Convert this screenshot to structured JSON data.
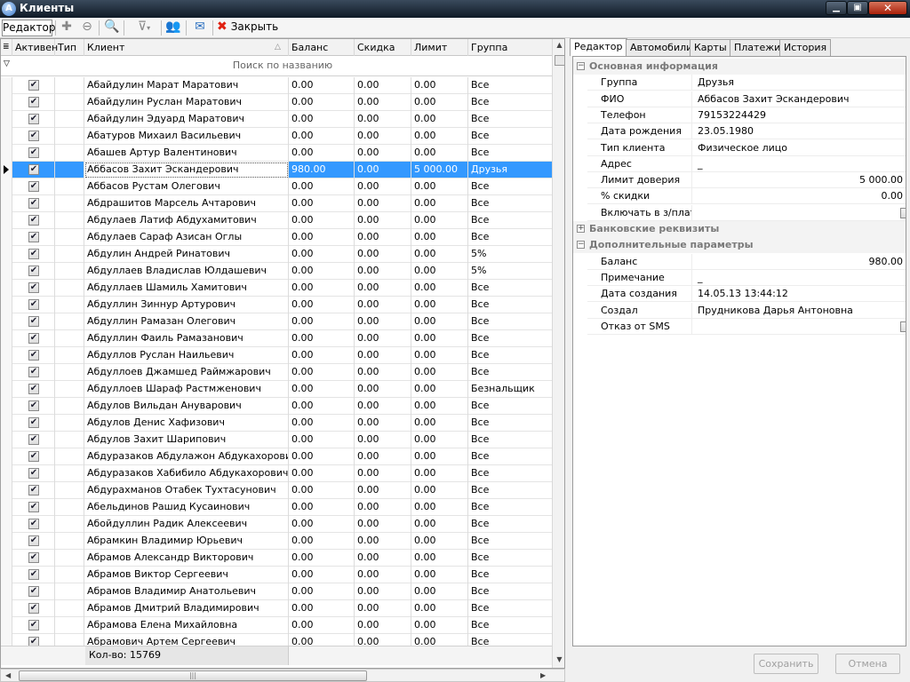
{
  "window": {
    "title": "Клиенты",
    "app_icon_letter": "A",
    "minimize": "▁",
    "maximize": "▣",
    "close": "✕"
  },
  "toolbar": {
    "editor_label": "Редактор",
    "close_label": "Закрыть"
  },
  "grid": {
    "columns": [
      "Активен",
      "Тип",
      "Клиент",
      "Баланс",
      "Скидка",
      "Лимит",
      "Группа"
    ],
    "sort_indicator": "△",
    "search_placeholder": "Поиск по названию",
    "filter_glyph": "▽",
    "check_glyph": "✔",
    "rows": [
      {
        "name": "Абайдулин Марат Маратович",
        "balance": "0.00",
        "discount": "0.00",
        "limit": "0.00",
        "group": "Все"
      },
      {
        "name": "Абайдулин Руслан Маратович",
        "balance": "0.00",
        "discount": "0.00",
        "limit": "0.00",
        "group": "Все"
      },
      {
        "name": "Абайдулин Эдуард Маратович",
        "balance": "0.00",
        "discount": "0.00",
        "limit": "0.00",
        "group": "Все"
      },
      {
        "name": "Абатуров Михаил Васильевич",
        "balance": "0.00",
        "discount": "0.00",
        "limit": "0.00",
        "group": "Все"
      },
      {
        "name": "Абашев Артур Валентинович",
        "balance": "0.00",
        "discount": "0.00",
        "limit": "0.00",
        "group": "Все"
      },
      {
        "name": "Аббасов Захит Эскандерович",
        "balance": "980.00",
        "discount": "0.00",
        "limit": "5 000.00",
        "group": "Друзья",
        "selected": true
      },
      {
        "name": "Аббасов Рустам Олегович",
        "balance": "0.00",
        "discount": "0.00",
        "limit": "0.00",
        "group": "Все"
      },
      {
        "name": "Абдрашитов Марсель Ачтарович",
        "balance": "0.00",
        "discount": "0.00",
        "limit": "0.00",
        "group": "Все"
      },
      {
        "name": "Абдулаев Латиф Абдухамитович",
        "balance": "0.00",
        "discount": "0.00",
        "limit": "0.00",
        "group": "Все"
      },
      {
        "name": "Абдулаев Сараф Азисан Оглы",
        "balance": "0.00",
        "discount": "0.00",
        "limit": "0.00",
        "group": "Все"
      },
      {
        "name": "Абдулин Андрей Ринатович",
        "balance": "0.00",
        "discount": "0.00",
        "limit": "0.00",
        "group": "5%"
      },
      {
        "name": "Абдуллаев Владислав Юлдашевич",
        "balance": "0.00",
        "discount": "0.00",
        "limit": "0.00",
        "group": "5%"
      },
      {
        "name": "Абдуллаев Шамиль Хамитович",
        "balance": "0.00",
        "discount": "0.00",
        "limit": "0.00",
        "group": "Все"
      },
      {
        "name": "Абдуллин Зиннур Артурович",
        "balance": "0.00",
        "discount": "0.00",
        "limit": "0.00",
        "group": "Все"
      },
      {
        "name": "Абдуллин Рамазан Олегович",
        "balance": "0.00",
        "discount": "0.00",
        "limit": "0.00",
        "group": "Все"
      },
      {
        "name": "Абдуллин Фаиль Рамазанович",
        "balance": "0.00",
        "discount": "0.00",
        "limit": "0.00",
        "group": "Все"
      },
      {
        "name": "Абдуллов Руслан Наильевич",
        "balance": "0.00",
        "discount": "0.00",
        "limit": "0.00",
        "group": "Все"
      },
      {
        "name": "Абдуллоев Джамшед Раймжарович",
        "balance": "0.00",
        "discount": "0.00",
        "limit": "0.00",
        "group": "Все"
      },
      {
        "name": "Абдуллоев Шараф Растмженович",
        "balance": "0.00",
        "discount": "0.00",
        "limit": "0.00",
        "group": "Безнальщик"
      },
      {
        "name": "Абдулов Вильдан Ануварович",
        "balance": "0.00",
        "discount": "0.00",
        "limit": "0.00",
        "group": "Все"
      },
      {
        "name": "Абдулов Денис Хафизович",
        "balance": "0.00",
        "discount": "0.00",
        "limit": "0.00",
        "group": "Все"
      },
      {
        "name": "Абдулов Захит Шарипович",
        "balance": "0.00",
        "discount": "0.00",
        "limit": "0.00",
        "group": "Все"
      },
      {
        "name": "Абдуразаков Абдулажон Абдукахорович",
        "balance": "0.00",
        "discount": "0.00",
        "limit": "0.00",
        "group": "Все"
      },
      {
        "name": "Абдуразаков Хабибило Абдукахорович",
        "balance": "0.00",
        "discount": "0.00",
        "limit": "0.00",
        "group": "Все"
      },
      {
        "name": "Абдурахманов Отабек Тухтасунович",
        "balance": "0.00",
        "discount": "0.00",
        "limit": "0.00",
        "group": "Все"
      },
      {
        "name": "Абельдинов Рашид Кусаинович",
        "balance": "0.00",
        "discount": "0.00",
        "limit": "0.00",
        "group": "Все"
      },
      {
        "name": "Абойдуллин Радик Алексеевич",
        "balance": "0.00",
        "discount": "0.00",
        "limit": "0.00",
        "group": "Все"
      },
      {
        "name": "Абрамкин Владимир Юрьевич",
        "balance": "0.00",
        "discount": "0.00",
        "limit": "0.00",
        "group": "Все"
      },
      {
        "name": "Абрамов Александр Викторович",
        "balance": "0.00",
        "discount": "0.00",
        "limit": "0.00",
        "group": "Все"
      },
      {
        "name": "Абрамов Виктор Сергеевич",
        "balance": "0.00",
        "discount": "0.00",
        "limit": "0.00",
        "group": "Все"
      },
      {
        "name": "Абрамов Владимир Анатольевич",
        "balance": "0.00",
        "discount": "0.00",
        "limit": "0.00",
        "group": "Все"
      },
      {
        "name": "Абрамов Дмитрий Владимирович",
        "balance": "0.00",
        "discount": "0.00",
        "limit": "0.00",
        "group": "Все"
      },
      {
        "name": "Абрамова Елена Михайловна",
        "balance": "0.00",
        "discount": "0.00",
        "limit": "0.00",
        "group": "Все"
      },
      {
        "name": "Абрамович Артем Сергеевич",
        "balance": "0.00",
        "discount": "0.00",
        "limit": "0.00",
        "group": "Все"
      }
    ],
    "footer_count": "Кол-во: 15769"
  },
  "panel": {
    "tabs": [
      "Редактор",
      "Автомобили",
      "Карты",
      "Платежи",
      "История"
    ],
    "sections": {
      "main": {
        "title": "Основная информация",
        "toggle": "−"
      },
      "bank": {
        "title": "Банковские реквизиты",
        "toggle": "+"
      },
      "extra": {
        "title": "Дополнительные параметры",
        "toggle": "−"
      }
    },
    "main_fields": [
      {
        "key": "Группа",
        "value": "Друзья"
      },
      {
        "key": "ФИО",
        "value": "Аббасов Захит Эскандерович"
      },
      {
        "key": "Телефон",
        "value": "79153224429"
      },
      {
        "key": "Дата рождения",
        "value": "23.05.1980"
      },
      {
        "key": "Тип клиента",
        "value": "Физическое лицо"
      },
      {
        "key": "Адрес",
        "value": "_"
      },
      {
        "key": "Лимит доверия",
        "value": "5 000.00",
        "align": "right"
      },
      {
        "key": "% скидки",
        "value": "0.00",
        "align": "right"
      },
      {
        "key": "Включать в з/плату",
        "checkbox": true
      }
    ],
    "extra_fields": [
      {
        "key": "Баланс",
        "value": "980.00",
        "align": "right"
      },
      {
        "key": "Примечание",
        "value": "_"
      },
      {
        "key": "Дата создания",
        "value": "14.05.13 13:44:12"
      },
      {
        "key": "Создал",
        "value": "Прудникова Дарья Антоновна"
      },
      {
        "key": "Отказ от SMS",
        "checkbox": true
      }
    ],
    "save_label": "Сохранить",
    "cancel_label": "Отмена"
  },
  "icons": {
    "add": "✚",
    "remove": "⊖",
    "search": "🔍",
    "filter": "⊽",
    "clients": "👥",
    "mail": "✉",
    "close": "✖"
  }
}
